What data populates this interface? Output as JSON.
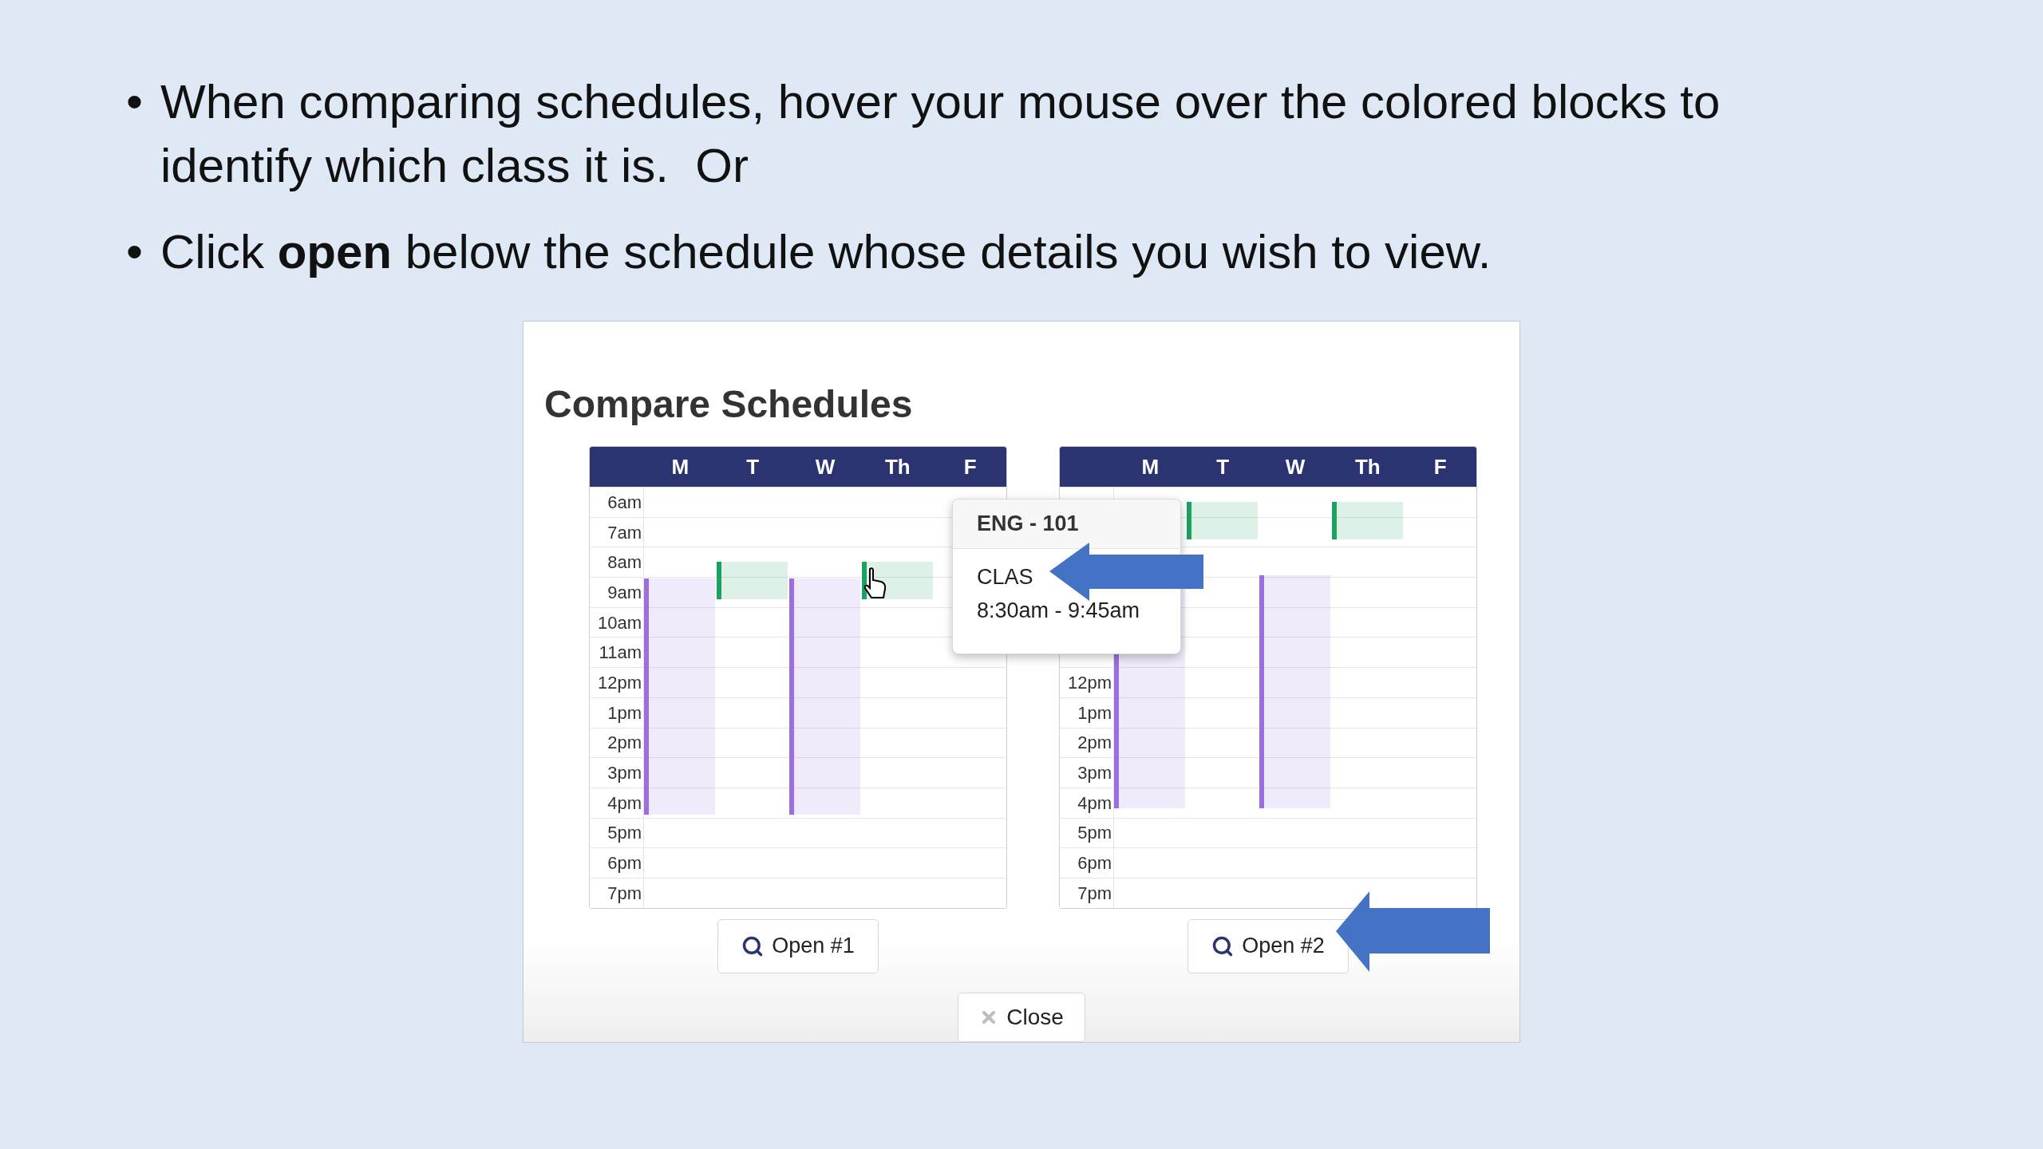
{
  "bullets": [
    {
      "marker": "•",
      "text": "When comparing schedules, hover your mouse over the colored blocks to identify which class it is.  Or"
    },
    {
      "marker": "•",
      "text": "Click **open** below the schedule whose details you wish to view."
    }
  ],
  "dialog": {
    "title": "Compare Schedules",
    "schedules": [
      {
        "days": [
          "M",
          "T",
          "W",
          "Th",
          "F"
        ],
        "times": [
          "6am",
          "7am",
          "8am",
          "9am",
          "10am",
          "11am",
          "12pm",
          "1pm",
          "2pm",
          "3pm",
          "4pm",
          "5pm",
          "6pm",
          "7pm"
        ],
        "blocks": [
          {
            "color": "#9b6fe0"
          },
          {
            "color": "#1aa260"
          },
          {
            "color": "#9b6fe0"
          },
          {
            "color": "#1aa260"
          }
        ],
        "button": "Open #1"
      },
      {
        "days": [
          "M",
          "T",
          "W",
          "Th",
          "F"
        ],
        "times": [
          "12pm",
          "1pm",
          "2pm",
          "3pm",
          "4pm",
          "5pm",
          "6pm",
          "7pm"
        ],
        "blocks": [
          {
            "color": "#9b6fe0"
          },
          {
            "color": "#1aa260"
          },
          {
            "color": "#9b6fe0"
          },
          {
            "color": "#1aa260"
          }
        ],
        "button": "Open #2"
      }
    ],
    "tooltip": {
      "title": "ENG - 101",
      "lines": [
        "CLAS",
        "8:30am - 9:45am"
      ]
    },
    "close_button": "Close"
  }
}
